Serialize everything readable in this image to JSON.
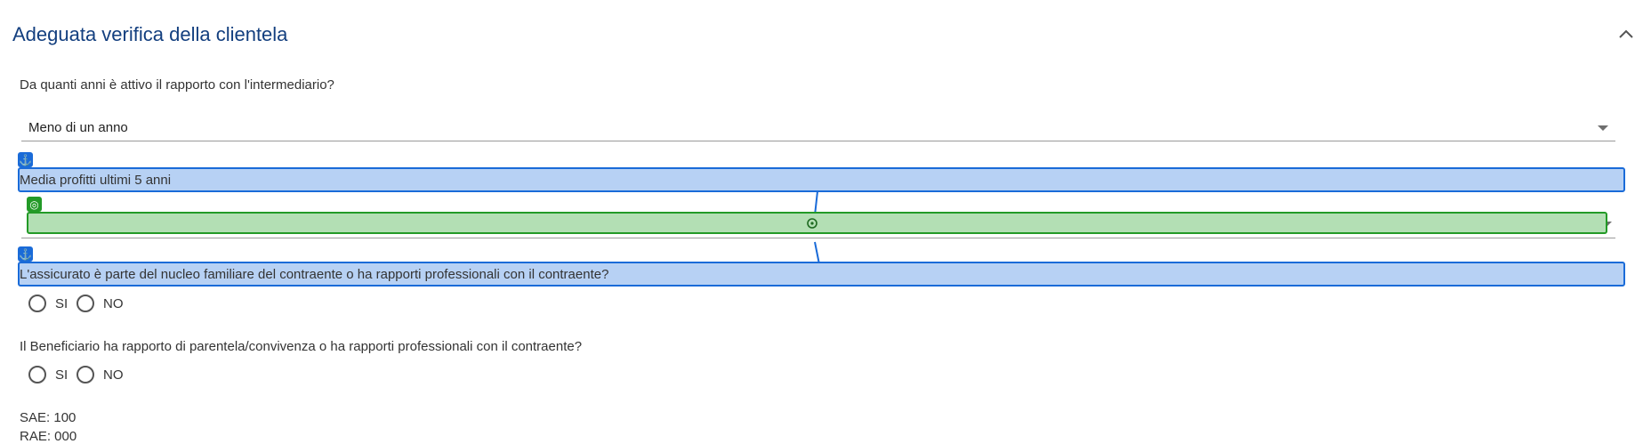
{
  "section": {
    "title": "Adeguata verifica della clientela",
    "collapse_icon": "chevron-up-icon"
  },
  "q1": {
    "label": "Da quanti anni è attivo il rapporto con l'intermediario?",
    "value": "Meno di un anno"
  },
  "q2": {
    "label": "Media profitti ultimi 5 anni",
    "value": ""
  },
  "q3": {
    "label": "L'assicurato è parte del nucleo familiare del contraente o ha rapporti professionali con il contraente?",
    "opt_si": "SI",
    "opt_no": "NO"
  },
  "q4": {
    "label": "Il Beneficiario ha rapporto di parentela/convivenza o ha rapporti professionali con il contraente?",
    "opt_si": "SI",
    "opt_no": "NO"
  },
  "info": {
    "sae": "SAE: 100",
    "rae": "RAE: 000"
  },
  "annotations": {
    "anchor_icon": "⚓",
    "target_icon": "◎"
  },
  "colors": {
    "title": "#133f7f",
    "highlight_blue": "#b7d1f4",
    "highlight_green": "#b3dfb4"
  }
}
